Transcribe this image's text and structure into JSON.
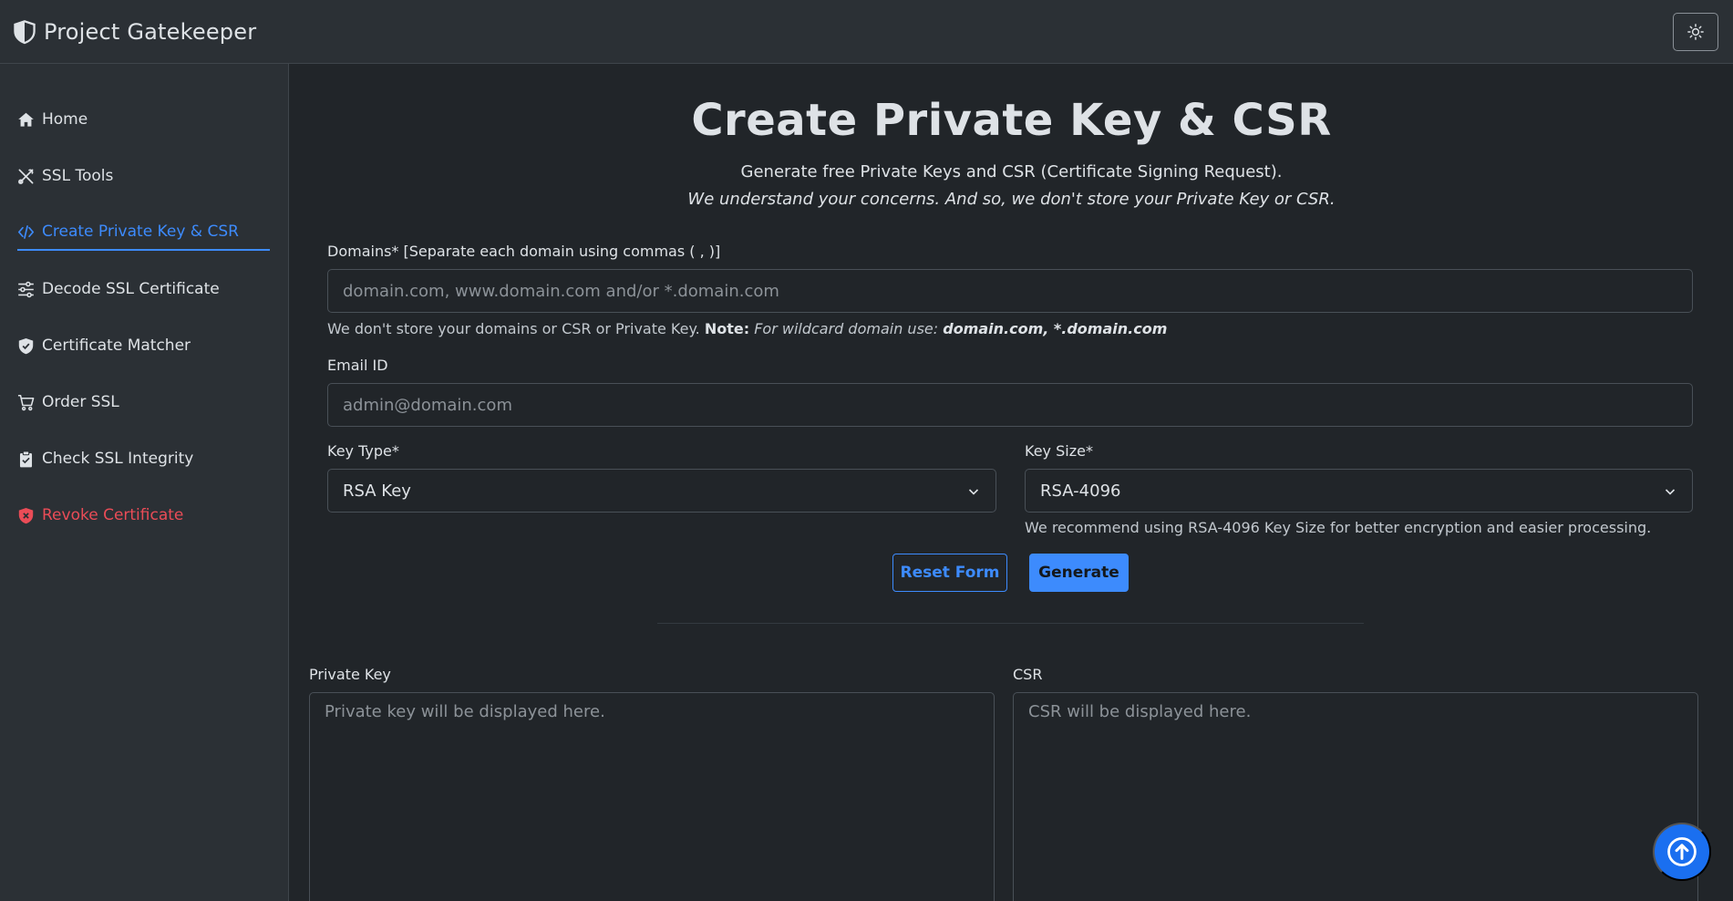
{
  "header": {
    "brand": "Project Gatekeeper",
    "brand_icon": "shield-half-icon",
    "theme_icon": "sun-icon"
  },
  "sidebar": {
    "items": [
      {
        "label": "Home",
        "icon": "house-icon",
        "active": false
      },
      {
        "label": "SSL Tools",
        "icon": "tools-icon",
        "active": false
      },
      {
        "label": "Create Private Key & CSR",
        "icon": "code-icon",
        "active": true
      },
      {
        "label": "Decode SSL Certificate",
        "icon": "sliders-icon",
        "active": false
      },
      {
        "label": "Certificate Matcher",
        "icon": "shield-check-icon",
        "active": false
      },
      {
        "label": "Order SSL",
        "icon": "cart-icon",
        "active": false
      },
      {
        "label": "Check SSL Integrity",
        "icon": "clipboard-icon",
        "active": false
      },
      {
        "label": "Revoke Certificate",
        "icon": "shield-x-icon",
        "active": false,
        "danger": true
      }
    ]
  },
  "main": {
    "title": "Create Private Key & CSR",
    "subtitle": "Generate free Private Keys and CSR (Certificate Signing Request).",
    "subtitle2": "We understand your concerns. And so, we don't store your Private Key or CSR.",
    "domains": {
      "label": "Domains* [Separate each domain using commas ( , )]",
      "placeholder": "domain.com, www.domain.com and/or *.domain.com",
      "value": "",
      "help_prefix": "We don't store your domains or CSR or Private Key.",
      "help_note": "Note:",
      "help_note_text": "For wildcard domain use:",
      "help_wildcard": "domain.com, *.domain.com"
    },
    "email": {
      "label": "Email ID",
      "placeholder": "admin@domain.com",
      "value": ""
    },
    "key_type": {
      "label": "Key Type*",
      "selected": "RSA Key"
    },
    "key_size": {
      "label": "Key Size*",
      "selected": "RSA-4096",
      "help": "We recommend using RSA-4096 Key Size for better encryption and easier processing."
    },
    "buttons": {
      "reset": "Reset Form",
      "generate": "Generate"
    },
    "private_key": {
      "label": "Private Key",
      "placeholder": "Private key will be displayed here."
    },
    "csr": {
      "label": "CSR",
      "placeholder": "CSR will be displayed here."
    }
  },
  "colors": {
    "background": "#212529",
    "panel": "#2b3035",
    "accent": "#3d8bfd",
    "danger": "#ea4c57",
    "scroll_top": "#1a6ff0"
  }
}
